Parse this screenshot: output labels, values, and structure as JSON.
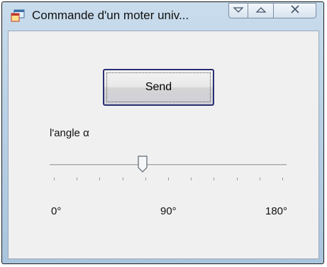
{
  "window": {
    "title": "Commande d'un moter univ...",
    "icons": {
      "app": "app-window-icon",
      "minimize": "minimize-icon",
      "maximize": "maximize-icon",
      "close": "close-icon"
    }
  },
  "form": {
    "send_label": "Send",
    "angle_label": "l'angle α",
    "slider": {
      "min": 0,
      "max": 180,
      "value": 70,
      "tick_count": 10
    },
    "scale": {
      "min_label": "0°",
      "mid_label": "90°",
      "max_label": "180°"
    }
  },
  "colors": {
    "button_border": "#2a2f72",
    "titlebar": "#b9d1e6",
    "client_bg": "#f0f0f0"
  }
}
